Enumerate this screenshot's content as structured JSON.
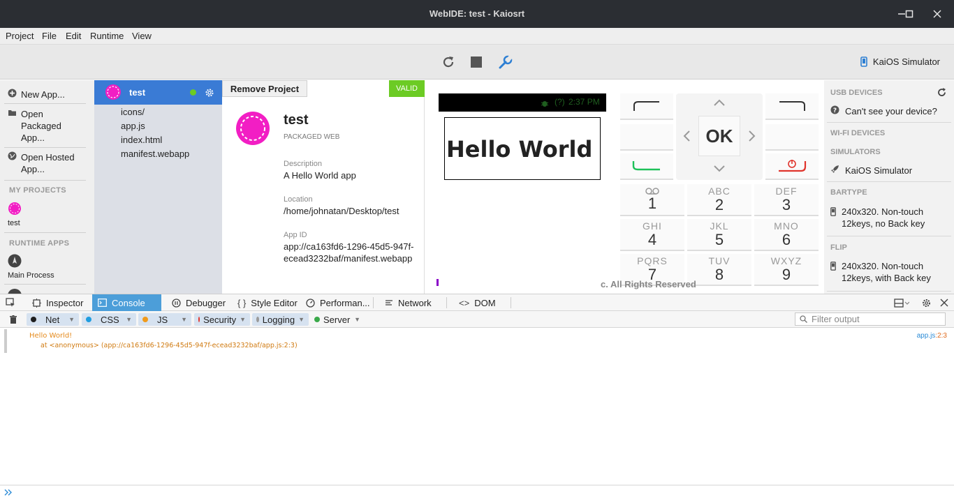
{
  "window": {
    "title": "WebIDE: test - Kaiosrt"
  },
  "menubar": {
    "project": "Project",
    "file": "File",
    "edit": "Edit",
    "runtime": "Runtime",
    "view": "View"
  },
  "toolbar": {
    "runtime_label": "KaiOS Simulator"
  },
  "left_panel": {
    "new_app": "New App...",
    "open_packaged_1": "Open",
    "open_packaged_2": "Packaged",
    "open_packaged_3": "App...",
    "open_hosted_1": "Open Hosted",
    "open_hosted_2": "App...",
    "my_projects_header": "MY PROJECTS",
    "project_name": "test",
    "runtime_apps_header": "RUNTIME APPS",
    "main_process": "Main Process"
  },
  "project_tree": {
    "selected_name": "test",
    "files": [
      "icons/",
      "app.js",
      "index.html",
      "manifest.webapp"
    ]
  },
  "project_details": {
    "remove_button": "Remove Project",
    "status_badge": "VALID",
    "name": "test",
    "type": "PACKAGED WEB",
    "description_label": "Description",
    "description": "A Hello World app",
    "location_label": "Location",
    "location": "/home/johnatan/Desktop/test",
    "appid_label": "App ID",
    "appid_line1": "app://ca163fd6-1296-45d5-947f-",
    "appid_line2": "ecead3232baf/manifest.webapp"
  },
  "simulator": {
    "status_time": "2:37 PM",
    "status_extra": "(?)",
    "hello_text": "Hello World",
    "ok_label": "OK",
    "keys": [
      {
        "letters": "",
        "num": "1"
      },
      {
        "letters": "ABC",
        "num": "2"
      },
      {
        "letters": "DEF",
        "num": "3"
      },
      {
        "letters": "GHI",
        "num": "4"
      },
      {
        "letters": "JKL",
        "num": "5"
      },
      {
        "letters": "MNO",
        "num": "6"
      },
      {
        "letters": "PQRS",
        "num": "7"
      },
      {
        "letters": "TUV",
        "num": "8"
      },
      {
        "letters": "WXYZ",
        "num": "9"
      }
    ],
    "copyright": "c. All Rights Reserved"
  },
  "device_panel": {
    "usb_header": "USB DEVICES",
    "cant_see": "Can't see your device?",
    "wifi_header": "WI-FI DEVICES",
    "simulators_header": "SIMULATORS",
    "kaios_sim": "KaiOS Simulator",
    "bartype_header": "BARTYPE",
    "bartype_line1": "240x320. Non-touch",
    "bartype_line2": "12keys, no Back key",
    "flip_header": "FLIP",
    "flip_line1": "240x320. Non-touch",
    "flip_line2": "12keys, with Back key"
  },
  "devtools": {
    "tabs": {
      "inspector": "Inspector",
      "console": "Console",
      "debugger": "Debugger",
      "style_editor": "Style Editor",
      "performance": "Performan...",
      "network": "Network",
      "dom": "DOM"
    },
    "filters": {
      "net": "Net",
      "css": "CSS",
      "js": "JS",
      "security": "Security",
      "logging": "Logging",
      "server": "Server"
    },
    "filter_placeholder": "Filter output",
    "colors": {
      "net": "#1f1f1f",
      "css": "#1f9de0",
      "js": "#f09a1b",
      "security": "#e0342c",
      "logging": "#9a9a9a",
      "server": "#3aa94a"
    }
  },
  "console_output": {
    "message": "Hello World!",
    "stack": "at <anonymous> (app://ca163fd6-1296-45d5-947f-ecead3232baf/app.js:2:3)",
    "source_file": "app.js",
    "source_pos": ":2:3"
  }
}
